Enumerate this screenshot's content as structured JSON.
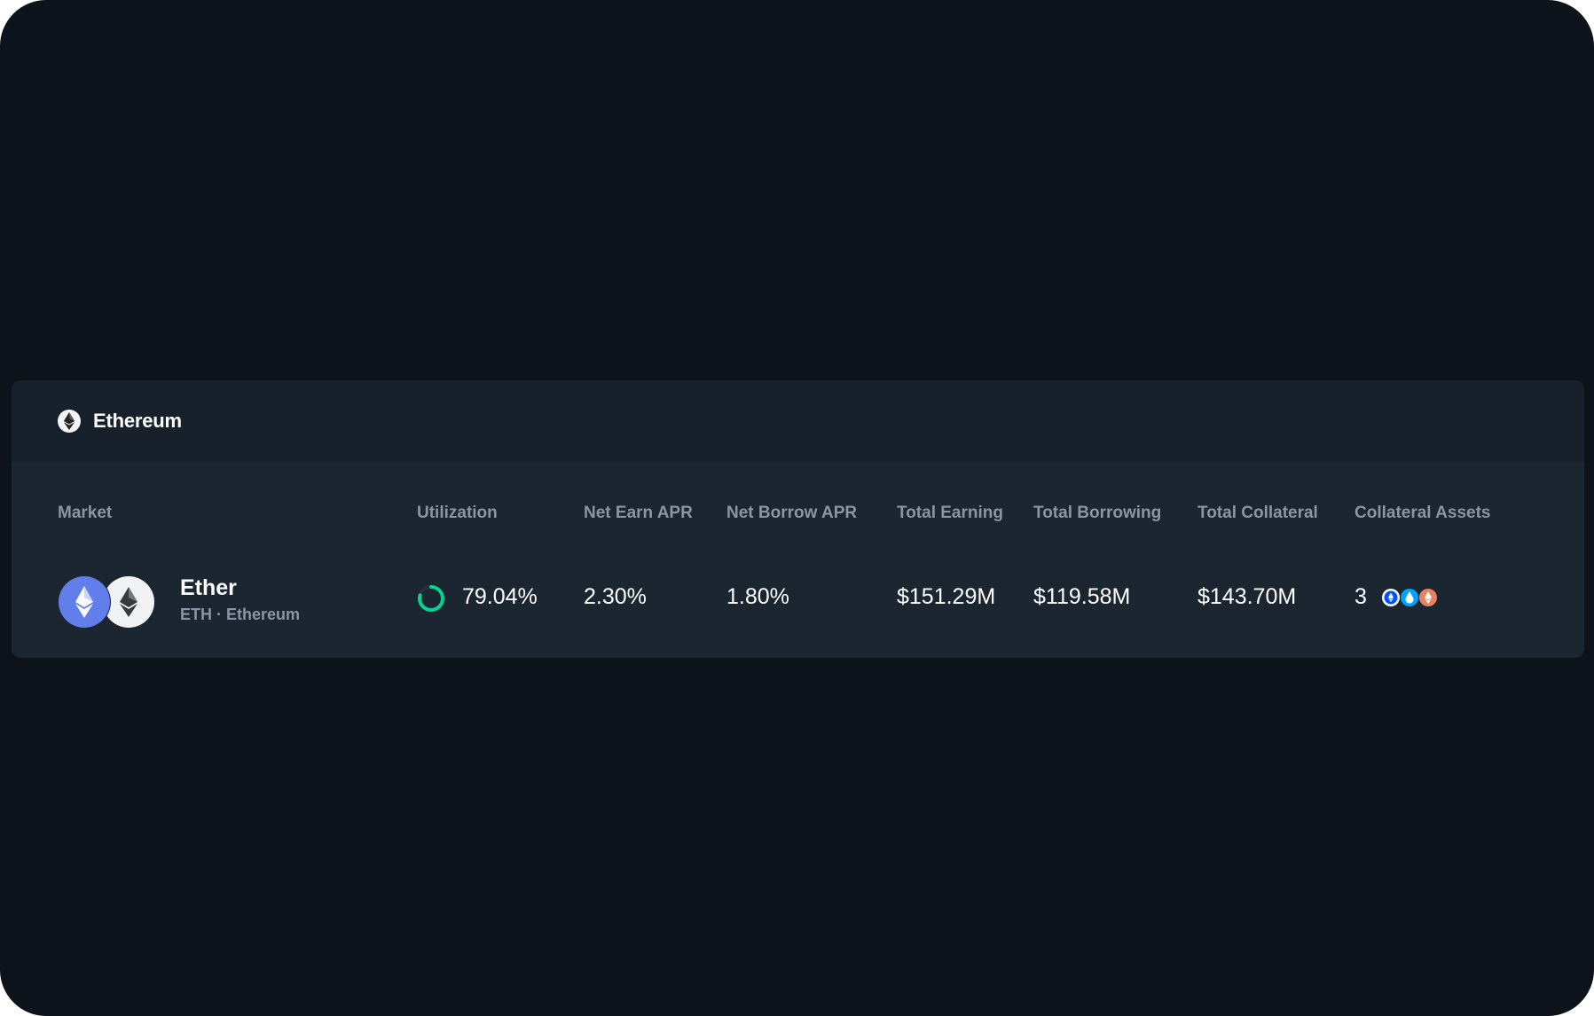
{
  "network": {
    "name": "Ethereum",
    "icon": "ethereum-logo-icon"
  },
  "table": {
    "columns": [
      {
        "key": "market",
        "label": "Market"
      },
      {
        "key": "utilization",
        "label": "Utilization"
      },
      {
        "key": "net_earn_apr",
        "label": "Net Earn APR"
      },
      {
        "key": "net_borrow_apr",
        "label": "Net Borrow APR"
      },
      {
        "key": "total_earning",
        "label": "Total Earning"
      },
      {
        "key": "total_borrowing",
        "label": "Total Borrowing"
      },
      {
        "key": "total_collateral",
        "label": "Total Collateral"
      },
      {
        "key": "collateral_assets",
        "label": "Collateral Assets"
      }
    ],
    "rows": [
      {
        "market": {
          "name": "Ether",
          "subtitle": "ETH · Ethereum",
          "icons": [
            "ether-token-icon",
            "ethereum-network-icon"
          ]
        },
        "utilization": "79.04%",
        "utilization_fraction": 0.7904,
        "net_earn_apr": "2.30%",
        "net_borrow_apr": "1.80%",
        "total_earning": "$151.29M",
        "total_borrowing": "$119.58M",
        "total_collateral": "$143.70M",
        "collateral_assets": {
          "count": "3",
          "icons": [
            "cbeth-icon",
            "wsteth-icon",
            "reth-icon"
          ]
        }
      }
    ]
  },
  "colors": {
    "background": "#0c131b",
    "card": "#1c2631",
    "card_header": "#18212b",
    "muted_text": "#8a96a3",
    "utilization_ring": "#00d395",
    "ether_blue": "#627eea"
  }
}
